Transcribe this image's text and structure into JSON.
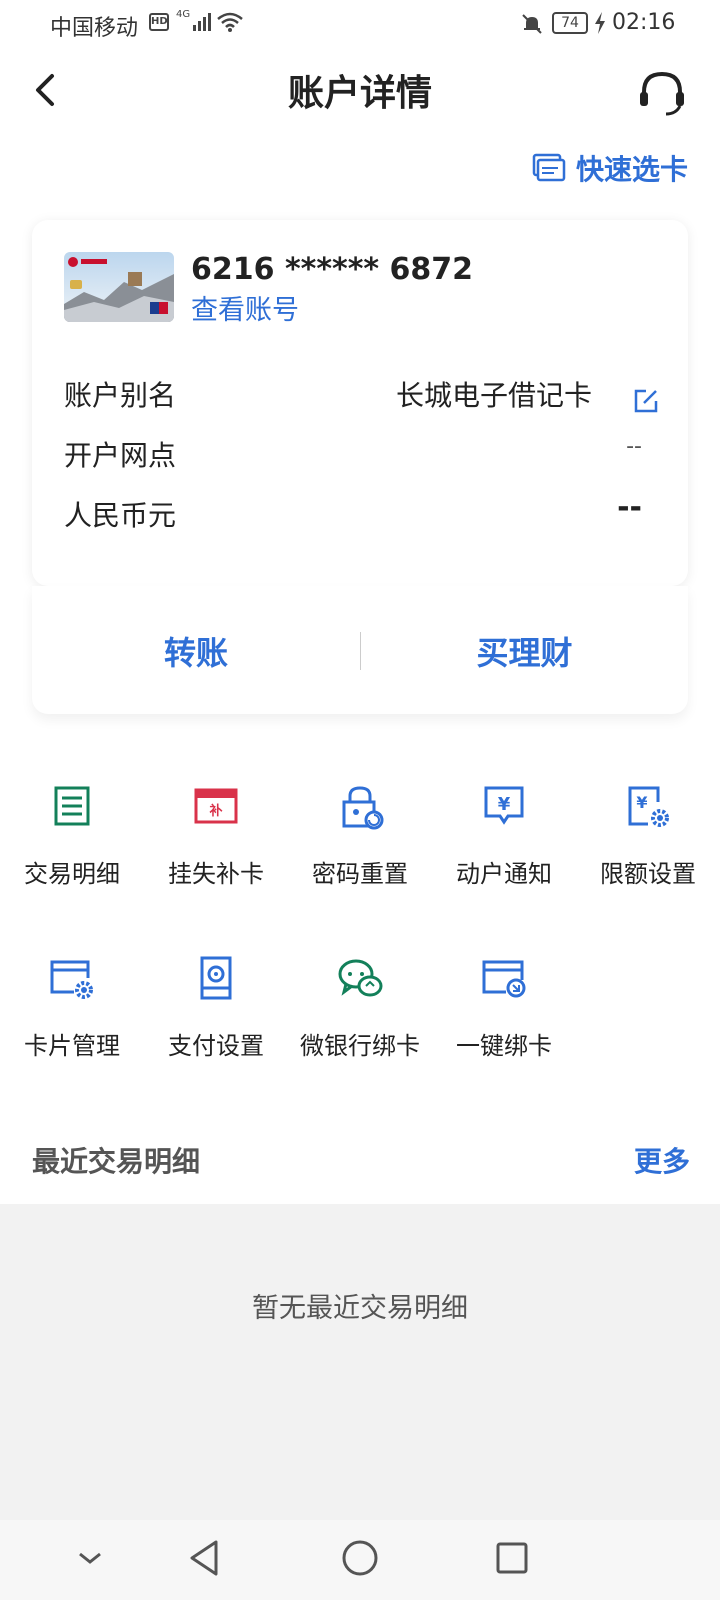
{
  "status_bar": {
    "carrier": "中国移动",
    "hd": "HD",
    "network": "4G",
    "battery": "74",
    "time": "02:16"
  },
  "header": {
    "title": "账户详情",
    "quick_select_label": "快速选卡"
  },
  "account_card": {
    "card_number": "6216 ****** 6872",
    "view_account_link": "查看账号",
    "rows": [
      {
        "label": "账户别名",
        "value": "长城电子借记卡"
      },
      {
        "label": "开户网点",
        "value": "--"
      },
      {
        "label": "人民币元",
        "value": "--"
      }
    ]
  },
  "card_actions": {
    "transfer": "转账",
    "buy_wealth": "买理财"
  },
  "services": [
    {
      "label": "交易明细",
      "icon": "document-list-icon",
      "color": "#13805a"
    },
    {
      "label": "挂失补卡",
      "icon": "card-replace-icon",
      "color": "#d9324a"
    },
    {
      "label": "密码重置",
      "icon": "lock-reset-icon",
      "color": "#2f6fd6"
    },
    {
      "label": "动户通知",
      "icon": "yen-notify-icon",
      "color": "#2f6fd6"
    },
    {
      "label": "限额设置",
      "icon": "yen-settings-icon",
      "color": "#2f6fd6"
    },
    {
      "label": "卡片管理",
      "icon": "card-gear-icon",
      "color": "#2f6fd6"
    },
    {
      "label": "支付设置",
      "icon": "payment-settings-icon",
      "color": "#2f6fd6"
    },
    {
      "label": "微银行绑卡",
      "icon": "wechat-bind-icon",
      "color": "#13805a"
    },
    {
      "label": "一键绑卡",
      "icon": "card-tap-icon",
      "color": "#2f6fd6"
    }
  ],
  "recent": {
    "title": "最近交易明细",
    "more": "更多",
    "empty": "暂无最近交易明细"
  },
  "colors": {
    "accent": "#2f6fd6",
    "green": "#13805a",
    "red": "#d9324a"
  }
}
